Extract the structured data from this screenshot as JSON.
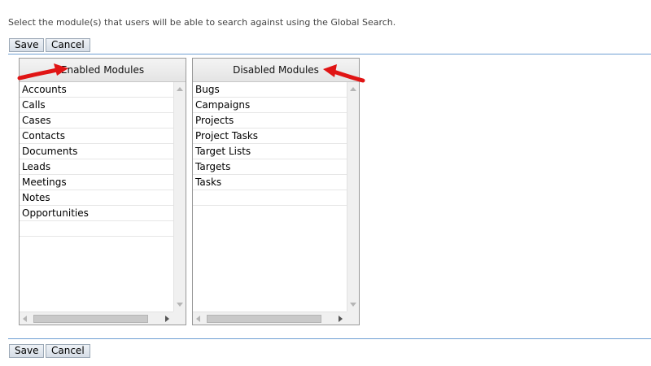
{
  "instructions": "Select the module(s) that users will be able to search against using the Global Search.",
  "top_actions": {
    "save": "Save",
    "cancel": "Cancel"
  },
  "bottom_actions": {
    "save": "Save",
    "cancel": "Cancel"
  },
  "enabled": {
    "title": "Enabled Modules",
    "items": [
      "Accounts",
      "Calls",
      "Cases",
      "Contacts",
      "Documents",
      "Leads",
      "Meetings",
      "Notes",
      "Opportunities"
    ]
  },
  "disabled": {
    "title": "Disabled Modules",
    "items": [
      "Bugs",
      "Campaigns",
      "Projects",
      "Project Tasks",
      "Target Lists",
      "Targets",
      "Tasks"
    ]
  },
  "colors": {
    "annotation_arrow": "#e01414",
    "separator": "#6f9fd3"
  },
  "icons": [
    "red-arrow-annotation-icon",
    "scroll-up-icon",
    "scroll-down-icon",
    "scroll-left-icon",
    "scroll-right-icon"
  ]
}
